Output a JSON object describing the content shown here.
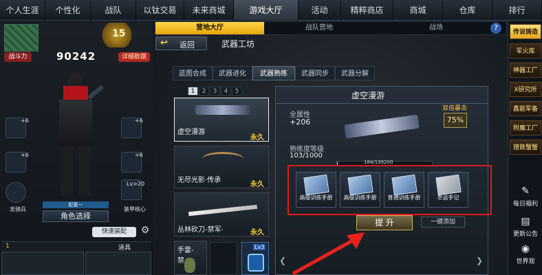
{
  "topnav": {
    "tabs": [
      {
        "label": "个人生涯",
        "w": 66
      },
      {
        "label": "个性化",
        "w": 66
      },
      {
        "label": "战队",
        "w": 66
      },
      {
        "label": "以钛交易",
        "w": 70
      },
      {
        "label": "未来商城",
        "w": 72
      },
      {
        "label": "游戏大厅",
        "w": 94,
        "active": true
      },
      {
        "label": "活动",
        "w": 62
      },
      {
        "label": "精粹商店",
        "w": 76
      },
      {
        "label": "商城",
        "w": 72
      },
      {
        "label": "仓库",
        "w": 72
      },
      {
        "label": "排行",
        "w": 72
      }
    ]
  },
  "subnav": {
    "tabs": [
      "营地大厅",
      "战队营地",
      "战场"
    ],
    "help": "?"
  },
  "header": {
    "back": "返回",
    "title": "武器工坊"
  },
  "player": {
    "level": "15",
    "power_label": "战斗力",
    "power_value": "90242",
    "detail_btn": "详细数据",
    "gear_left": [
      {
        "label": "+6"
      },
      {
        "label": "+6"
      },
      {
        "label": "龙骑兵"
      }
    ],
    "gear_right": [
      {
        "label": "+6"
      },
      {
        "label": "+6"
      },
      {
        "label": "Lv>20"
      },
      {
        "label": "装甲核心"
      }
    ],
    "equip_label": "配置一",
    "role_select": "角色选择",
    "quick_equip": "快速装配",
    "bottom_tab": "道具",
    "bottom_num": "1"
  },
  "workshop": {
    "tabs": [
      "蓝图合成",
      "武器进化",
      "武器熟练",
      "武器同步",
      "武器分解"
    ],
    "active_tab": "武器熟练",
    "pages": [
      "1",
      "2",
      "3",
      "4",
      "5"
    ],
    "weapons": [
      {
        "name": "虚空漫游",
        "perm": "永久"
      },
      {
        "name": "无尽光影·传承",
        "perm": "永久"
      },
      {
        "name": "丛林砍刀-禁军·",
        "perm": "永久"
      },
      {
        "name": "手雷-禁...",
        "perm": ""
      }
    ],
    "lv_badge": "Lv3"
  },
  "detail": {
    "weapon_name": "虚空漫游",
    "attr_label": "全属性",
    "attr_value": "+206",
    "crit_label": "双倍暴击",
    "crit_value": "75%",
    "prof_label": "熟练度等级",
    "prof_value": "103/1000",
    "bar_text": "184/139200",
    "bar_fill": 0.0013,
    "manuals": [
      "高级训练手册",
      "高级训练手册",
      "普通训练手册",
      "幸运手记"
    ],
    "upgrade_btn": "提 升",
    "auto_add": "一键添加"
  },
  "rightbar": {
    "items": [
      "传说铸造",
      "军火库",
      "神器工厂",
      "X研究所",
      "鑫能军备",
      "附魔工厂",
      "猎鉄蟹蟹"
    ],
    "icons": [
      {
        "label": "每日福利",
        "icon": "gift-icon"
      },
      {
        "label": "更新公告",
        "icon": "news-icon"
      },
      {
        "label": "世界观",
        "icon": "globe-icon"
      }
    ]
  },
  "colors": {
    "accent": "#f5c518",
    "highlight_box": "#e01b1b",
    "arrow": "#e8221a"
  }
}
